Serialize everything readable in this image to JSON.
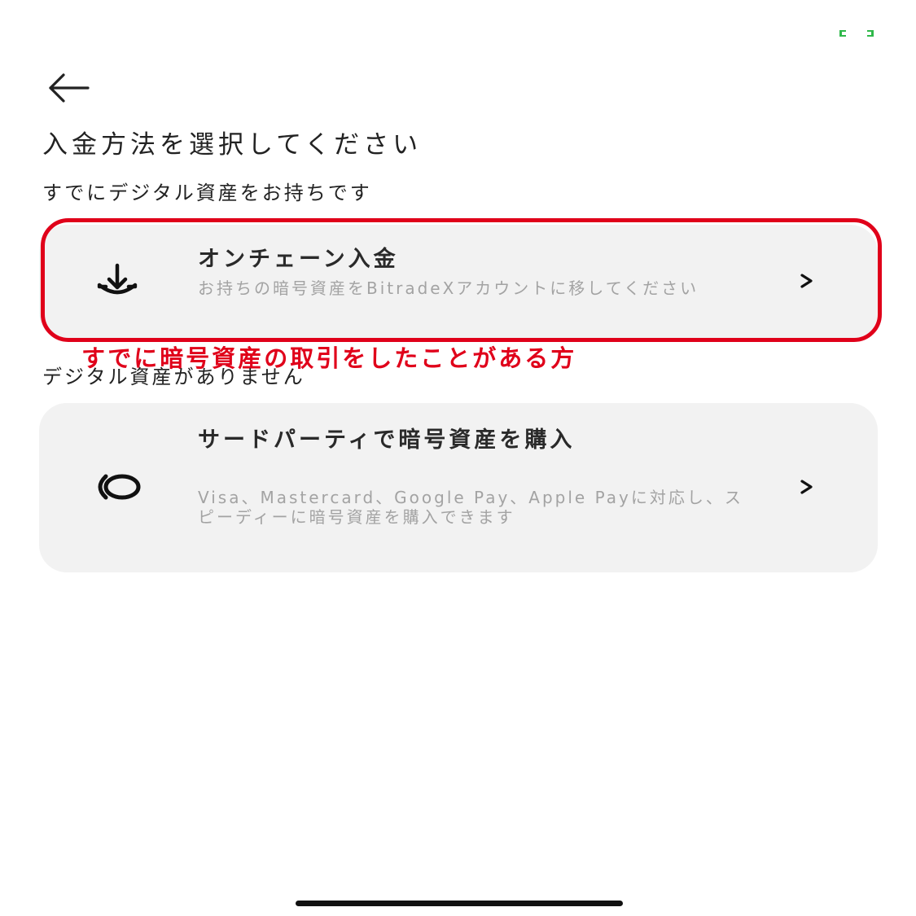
{
  "status_bar": {
    "indicator_icon": "battery-status-icon",
    "indicator_color": "#2fb84a"
  },
  "header": {
    "back_icon": "arrow-left-icon"
  },
  "page": {
    "title": "入金方法を選択してください"
  },
  "sections": [
    {
      "label": "すでにデジタル資産をお持ちです",
      "card": {
        "icon": "download-icon",
        "title": "オンチェーン入金",
        "description": "お持ちの暗号資産をBitradeXアカウントに移してください",
        "chevron_icon": "chevron-right-icon"
      }
    },
    {
      "label": "デジタル資産がありません",
      "card": {
        "icon": "third-party-icon",
        "title": "サードパーティで暗号資産を購入",
        "description": "Visa、Mastercard、Google Pay、Apple Payに対応し、スピーディーに暗号資産を購入できます",
        "chevron_icon": "chevron-right-icon"
      }
    }
  ],
  "annotation": {
    "text": "すでに暗号資産の取引をしたことがある方",
    "color": "#e0001a"
  }
}
